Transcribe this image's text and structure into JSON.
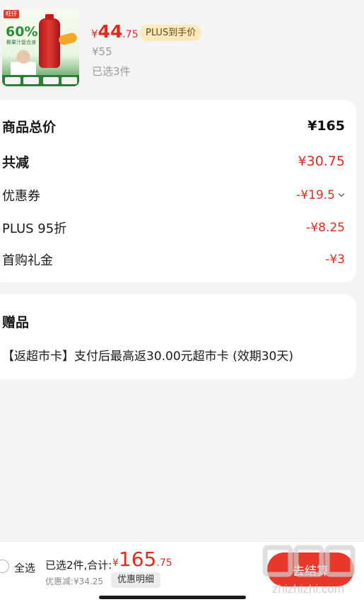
{
  "product": {
    "thumb_brand": "旺仔",
    "thumb_percent": "60%",
    "thumb_subtitle": "椰果汁复合液",
    "price_currency": "¥",
    "price_int": "44",
    "price_dec": ".75",
    "plus_badge": "PLUS到手价",
    "original_price": "¥55",
    "selected_count": "已选3件"
  },
  "summary": {
    "total_label": "商品总价",
    "total_value": "¥165",
    "reduce_label": "共减",
    "reduce_value": "¥30.75",
    "coupon_label": "优惠券",
    "coupon_value": "-¥19.5",
    "plus_label": "PLUS 95折",
    "plus_value": "-¥8.25",
    "first_label": "首购礼金",
    "first_value": "-¥3"
  },
  "gift": {
    "title": "赠品",
    "line": "【返超市卡】支付后最高返30.00元超市卡 (效期30天)"
  },
  "footer": {
    "select_all": "全选",
    "selected_sum_label": "已选2件,合计:",
    "total_currency": "¥",
    "total_int": "165",
    "total_dec": ".75",
    "discount_label": "优惠减:¥34.25",
    "detail_button": "优惠明细",
    "checkout_button": "去结算",
    "watermark_text": "zhizhizhi.com"
  },
  "colors": {
    "accent_red": "#e22a1d",
    "plus_gold": "#fbe8bd",
    "checkout_red": "#e8372b"
  }
}
